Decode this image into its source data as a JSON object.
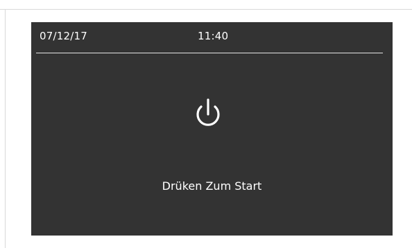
{
  "status_bar": {
    "date": "07/12/17",
    "time": "11:40"
  },
  "main": {
    "power_icon": "power-icon",
    "start_label": "Drüken Zum Start"
  },
  "colors": {
    "screen_background": "#333333",
    "text": "#ffffff",
    "divider": "#e6e6e6"
  }
}
